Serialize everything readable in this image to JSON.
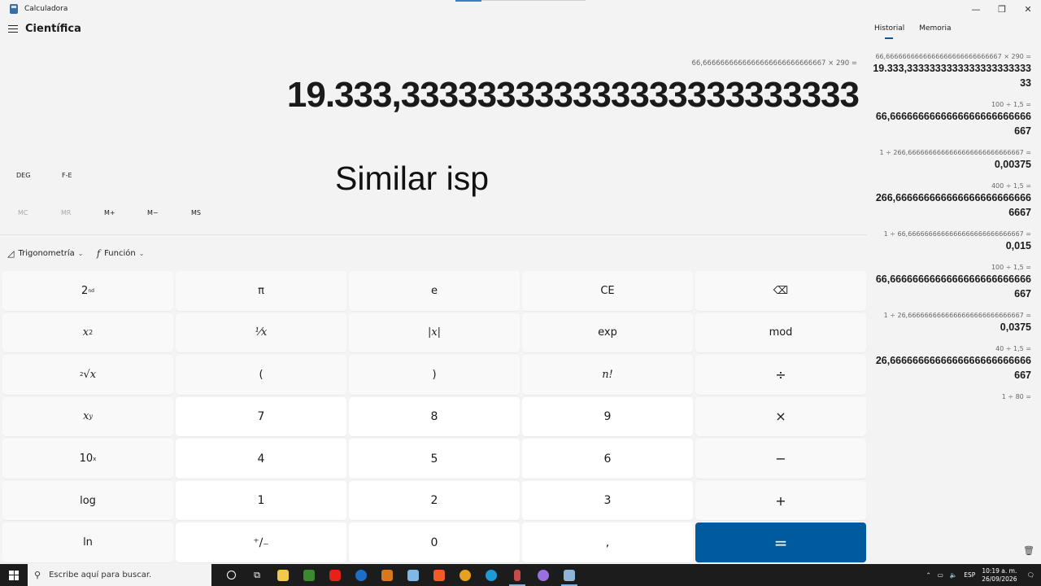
{
  "window": {
    "title": "Calculadora",
    "minimize": "—",
    "maximize": "❐",
    "close": "✕"
  },
  "header": {
    "mode": "Científica"
  },
  "display": {
    "expression": "66,6666666666666666666666666667 × 290 =",
    "result": "19.333,333333333333333333333333",
    "overlay": "Similar isp"
  },
  "modes": {
    "angle": "DEG",
    "format": "F-E"
  },
  "memory": {
    "mc": "MC",
    "mr": "MR",
    "mplus": "M+",
    "mminus": "M−",
    "ms": "MS"
  },
  "dropdowns": {
    "trig": "Trigonometría",
    "func": "Función"
  },
  "keys": {
    "second": "2",
    "second_sup": "nd",
    "pi": "π",
    "e": "e",
    "ce": "CE",
    "backspace": "⌫",
    "xsq": "x",
    "xsq_sup": "2",
    "reciprocal": "⅟x",
    "abs": "|x|",
    "exp": "exp",
    "mod": "mod",
    "root_pre": "2",
    "root": "√x",
    "lparen": "(",
    "rparen": ")",
    "fact": "n!",
    "divide": "÷",
    "xy": "x",
    "xy_sup": "y",
    "seven": "7",
    "eight": "8",
    "nine": "9",
    "multiply": "×",
    "ten": "10",
    "ten_sup": "x",
    "four": "4",
    "five": "5",
    "six": "6",
    "minus": "−",
    "log": "log",
    "one": "1",
    "two": "2",
    "three": "3",
    "plus": "+",
    "ln": "ln",
    "negate": "⁺∕₋",
    "zero": "0",
    "decimal": ",",
    "equals": "="
  },
  "history_panel": {
    "tab_history": "Historial",
    "tab_memory": "Memoria",
    "items": [
      {
        "expr": "66,6666666666666666666666666667 × 290 =",
        "result": "19.333,333333333333333333333333"
      },
      {
        "expr": "100 ÷ 1,5 =",
        "result": "66,6666666666666666666666666667"
      },
      {
        "expr": "1 ÷ 266,6666666666666666666666666667 =",
        "result": "0,00375"
      },
      {
        "expr": "400 ÷ 1,5 =",
        "result": "266,6666666666666666666666666667"
      },
      {
        "expr": "1 ÷ 66,6666666666666666666666666667 =",
        "result": "0,015"
      },
      {
        "expr": "100 ÷ 1,5 =",
        "result": "66,6666666666666666666666666667"
      },
      {
        "expr": "1 ÷ 26,6666666666666666666666666667 =",
        "result": "0,0375"
      },
      {
        "expr": "40 ÷ 1,5 =",
        "result": "26,6666666666666666666666666667"
      },
      {
        "expr": "1 ÷ 80 =",
        "result": ""
      }
    ]
  },
  "taskbar": {
    "search_placeholder": "Escribe aquí para buscar.",
    "language": "ESP",
    "time": "10:19 a. m.",
    "date": "26/09/2026"
  },
  "colors": {
    "accent": "#005a9e",
    "taskbar": "#1c1c1c"
  }
}
